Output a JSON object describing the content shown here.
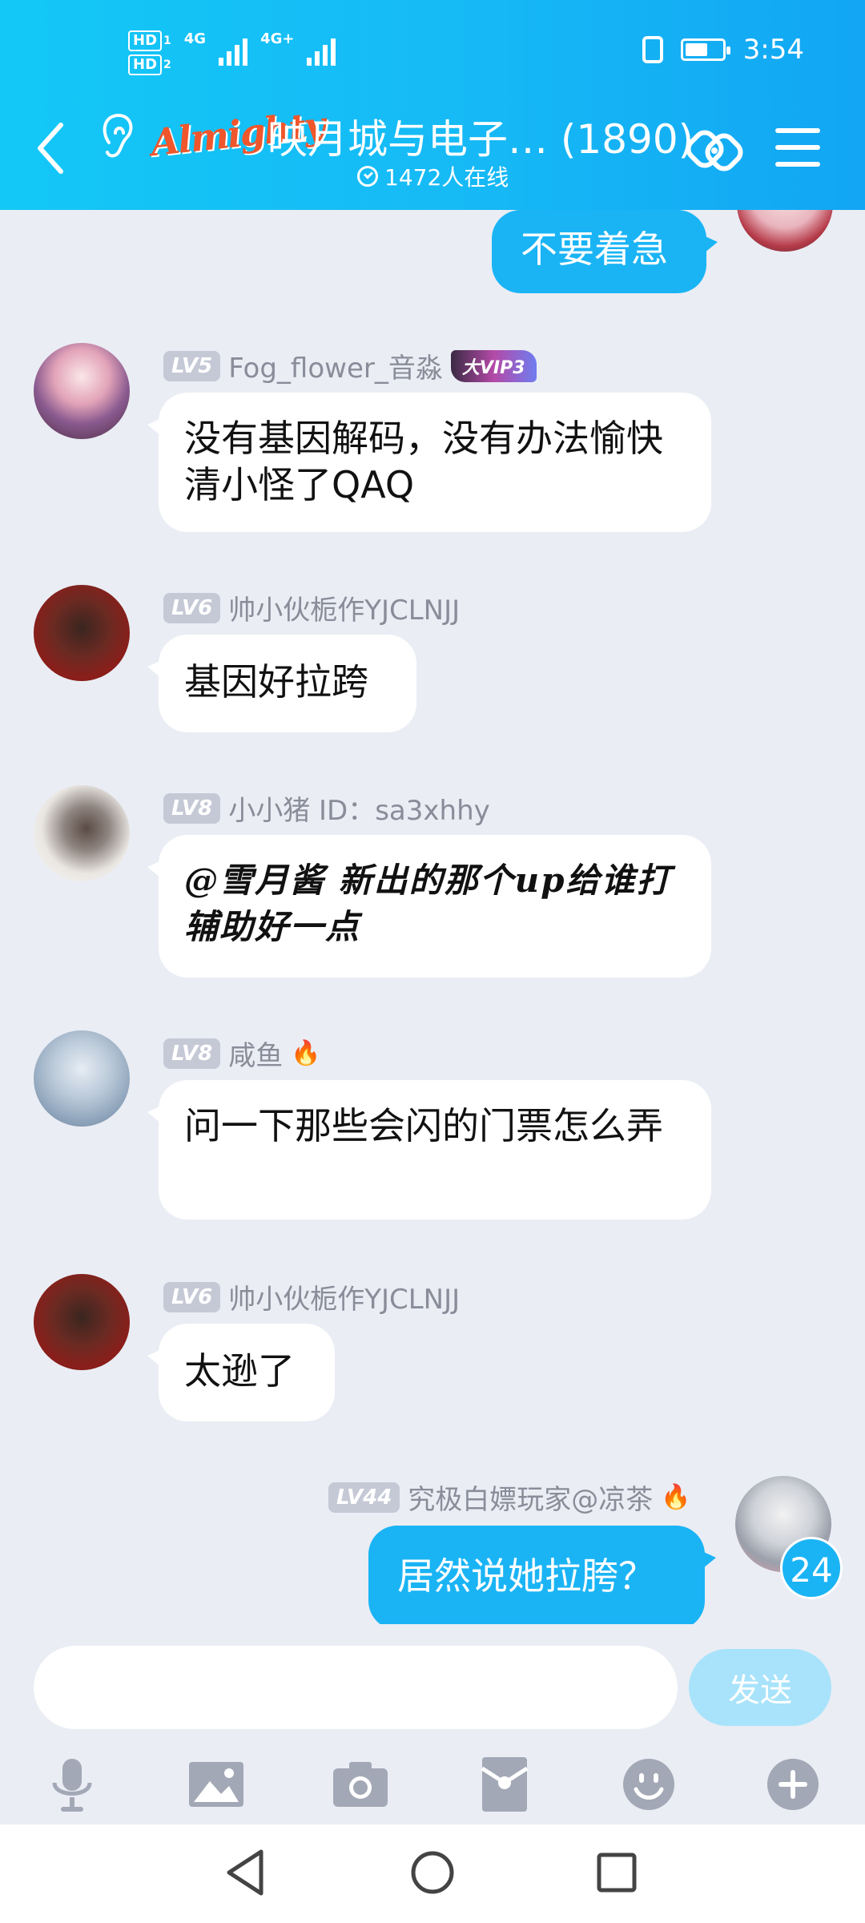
{
  "status_bar": {
    "hd1": "HD",
    "hd1_sub": "1",
    "hd2": "HD",
    "hd2_sub": "2",
    "net1": "4G",
    "net2": "4G+",
    "time": "3:54"
  },
  "header": {
    "brand": "Almighty",
    "title": "映月城与电子… (1890)",
    "online": "1472人在线"
  },
  "messages": [
    {
      "text": "不要着急",
      "mine": true
    },
    {
      "level": "LV5",
      "name": "Fog_flower_音淼",
      "vip": "大VIP3",
      "text": "没有基因解码，没有办法愉快清小怪了QAQ"
    },
    {
      "level": "LV6",
      "name": "帅小伙栀作YJCLNJJ",
      "text": "基因好拉跨"
    },
    {
      "level": "LV8",
      "name": "小小猪  ID：sa3xhhy",
      "text": "@雪月酱 新出的那个up给谁打辅助好一点"
    },
    {
      "level": "LV8",
      "name": "咸鱼",
      "text": "问一下那些会闪的门票怎么弄"
    },
    {
      "level": "LV6",
      "name": "帅小伙栀作YJCLNJJ",
      "text": "太逊了"
    },
    {
      "level": "LV44",
      "name": "究极白嫖玩家@凉茶",
      "text": "居然说她拉胯？",
      "mine": true
    }
  ],
  "unread_count": "24",
  "input": {
    "placeholder": "",
    "send_label": "发送"
  },
  "toolbar_icons": [
    "microphone-icon",
    "image-icon",
    "camera-icon",
    "red-packet-icon",
    "emoji-icon",
    "plus-icon"
  ],
  "colors": {
    "header": "#16b9f5",
    "bubble_mine": "#1ab4f5",
    "background": "#eaedf4",
    "send_disabled": "#a8e3fb"
  }
}
